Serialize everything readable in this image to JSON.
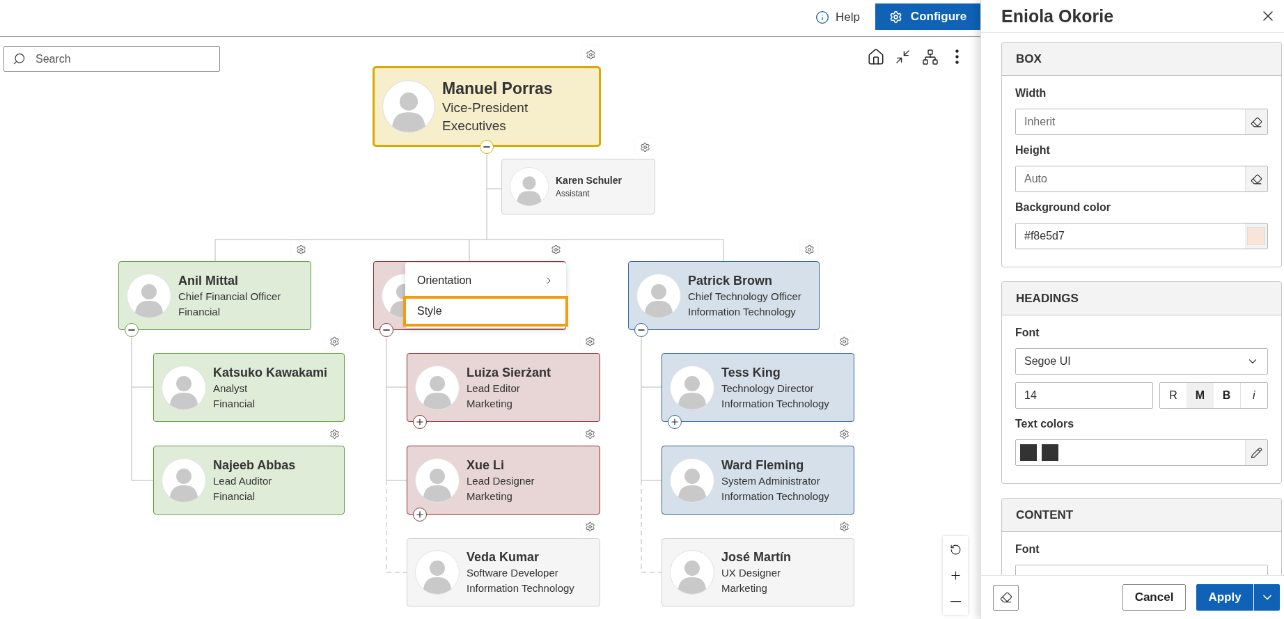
{
  "top_bar": {
    "help": "Help",
    "configure": "Configure"
  },
  "search": {
    "placeholder": "Search"
  },
  "chart": {
    "nodes": [
      {
        "name": "Manuel Porras",
        "title": "Vice-President",
        "department": "Executives",
        "color": "#d9a900",
        "expanded": true
      },
      {
        "name": "Karen Schuler",
        "title": "Assistant",
        "color": "#cfcfcf"
      },
      {
        "name": "Anil Mittal",
        "title": "Chief Financial Officer",
        "department": "Financial",
        "color": "#5f9e3e",
        "expanded": true
      },
      {
        "color": "#8b2f2f",
        "expanded": true
      },
      {
        "name": "Patrick Brown",
        "title": "Chief Technology Officer",
        "department": "Information Technology",
        "color": "#2f6494",
        "expanded": true
      },
      {
        "name": "Katsuko Kawakami",
        "title": "Analyst",
        "department": "Financial",
        "color": "#5f9e3e"
      },
      {
        "name": "Najeeb Abbas",
        "title": "Lead Auditor",
        "department": "Financial",
        "color": "#5f9e3e"
      },
      {
        "name": "Luiza Sierżant",
        "title": "Lead Editor",
        "department": "Marketing",
        "color": "#8b2f2f",
        "expanded": false
      },
      {
        "name": "Xue Li",
        "title": "Lead Designer",
        "department": "Marketing",
        "color": "#8b2f2f",
        "expanded": false
      },
      {
        "name": "Veda Kumar",
        "title": "Software Developer",
        "department": "Information Technology",
        "color": "#cfcfcf"
      },
      {
        "name": "Tess King",
        "title": "Technology Director",
        "department": "Information Technology",
        "color": "#2f6494",
        "expanded": false
      },
      {
        "name": "Ward Fleming",
        "title": "System Administrator",
        "department": "Information Technology",
        "color": "#2f6494"
      },
      {
        "name": "José Martín",
        "title": "UX Designer",
        "department": "Marketing",
        "color": "#cfcfcf"
      }
    ]
  },
  "context_menu": {
    "items": [
      {
        "label": "Orientation",
        "submenu": true,
        "selected": false
      },
      {
        "label": "Style",
        "submenu": false,
        "selected": true
      }
    ]
  },
  "panel": {
    "title": "Eniola Okorie",
    "sections": [
      {
        "title": "BOX",
        "fields": [
          {
            "kind": "clearable",
            "label": "Width",
            "placeholder": "Inherit"
          },
          {
            "kind": "clearable",
            "label": "Height",
            "placeholder": "Auto"
          },
          {
            "kind": "color",
            "label": "Background color",
            "value": "#f8e5d7",
            "color": "#f8e5d7"
          }
        ]
      },
      {
        "title": "HEADINGS",
        "fields": [
          {
            "kind": "select",
            "label": "Font",
            "value": "Segoe UI"
          },
          {
            "kind": "size_style",
            "value": "14",
            "styles": [
              {
                "label": "R",
                "selected": false
              },
              {
                "label": "M",
                "selected": true
              },
              {
                "label": "B",
                "selected": false
              },
              {
                "label": "i",
                "selected": false
              }
            ]
          },
          {
            "kind": "swatches",
            "label": "Text colors",
            "colors": [
              {
                "color": "#333333"
              },
              {
                "color": "#333333"
              }
            ]
          }
        ]
      },
      {
        "title": "CONTENT",
        "fields": [
          {
            "kind": "select",
            "label": "Font"
          }
        ]
      }
    ],
    "footer": {
      "cancel": "Cancel",
      "apply": "Apply"
    }
  }
}
